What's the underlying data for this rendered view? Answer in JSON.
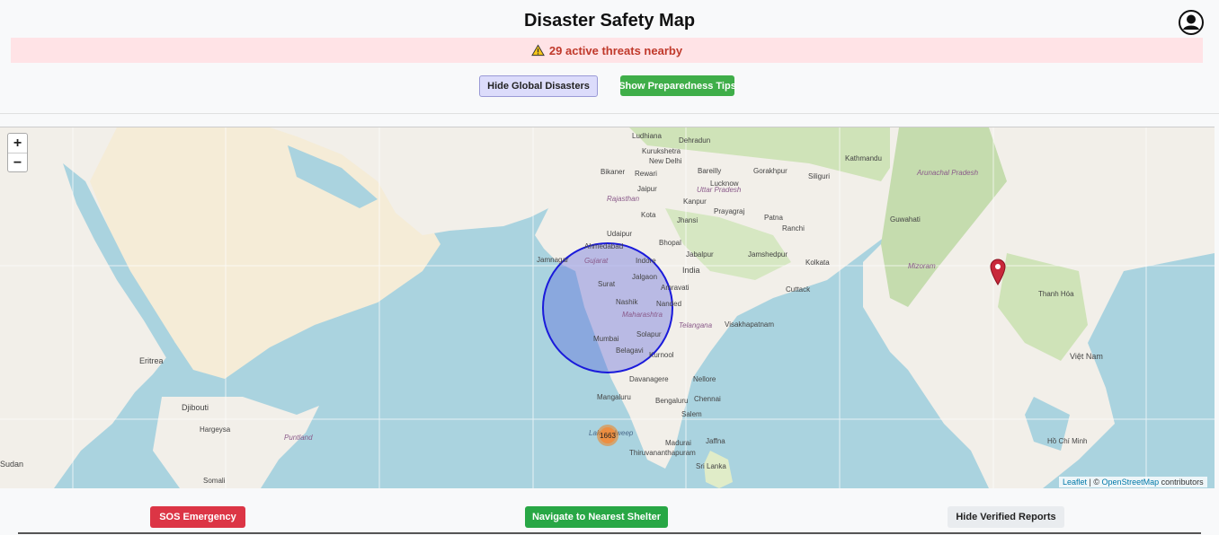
{
  "header": {
    "title": "Disaster Safety Map"
  },
  "alert": {
    "text": "29 active threats nearby",
    "color": "#c0392b",
    "background": "#ffe3e6"
  },
  "controls": {
    "global_toggle_label": "Hide Global Disasters",
    "tips_label": "Show Preparedness Tips"
  },
  "map": {
    "zoom_in": "+",
    "zoom_out": "−",
    "cluster_count": "1663",
    "attribution": {
      "leaflet": "Leaflet",
      "separator": "| ©",
      "osm": "OpenStreetMap",
      "suffix": "contributors"
    },
    "place_labels": [
      "Ludhiana",
      "Dehradun",
      "Kurukshetra",
      "New Delhi",
      "Bikaner",
      "Rewari",
      "Bareilly",
      "Jaipur",
      "Uttar Pradesh",
      "Gorakhpur",
      "Siliguri",
      "Rajasthan",
      "Kanpur",
      "Lucknow",
      "Kota",
      "Jhansi",
      "Prayagraj",
      "Patna",
      "Udaipur",
      "Ahmedabad",
      "Bhopal",
      "Ranchi",
      "Jamnagar",
      "Gujarat",
      "Indore",
      "Jabalpur",
      "Jamshedpur",
      "Kolkata",
      "India",
      "Surat",
      "Jalgaon",
      "Amravati",
      "Nashik",
      "Nanded",
      "Cuttack",
      "Mumbai",
      "Maharashtra",
      "Solapur",
      "Telangana",
      "Visakhapatnam",
      "Belagavi",
      "Kurnool",
      "Davanagere",
      "Nellore",
      "Mangaluru",
      "Bengaluru",
      "Chennai",
      "Salem",
      "Madurai",
      "Jaffna",
      "Thiruvananthapuram",
      "Sri Lanka",
      "Lakshadweep",
      "Eritrea",
      "Djibouti",
      "Hargeysa",
      "Puntland",
      "Somali",
      "Sudan",
      "Thanh Hóa",
      "Việt Nam",
      "Hồ Chí Minh",
      "Mizoram",
      "Arunachal Pradesh",
      "Kathmandu",
      "Guwahati"
    ]
  },
  "actions": {
    "sos_label": "SOS Emergency",
    "navigate_label": "Navigate to Nearest Shelter",
    "verified_label": "Hide Verified Reports"
  },
  "colors": {
    "sos": "#dc3545",
    "navigate": "#28a745",
    "tips": "#3fae49",
    "global_toggle": "#dcdcfb",
    "radius_circle": "#1a1adb"
  },
  "icons": [
    "user-profile-icon",
    "warning-icon",
    "map-pin-icon"
  ]
}
